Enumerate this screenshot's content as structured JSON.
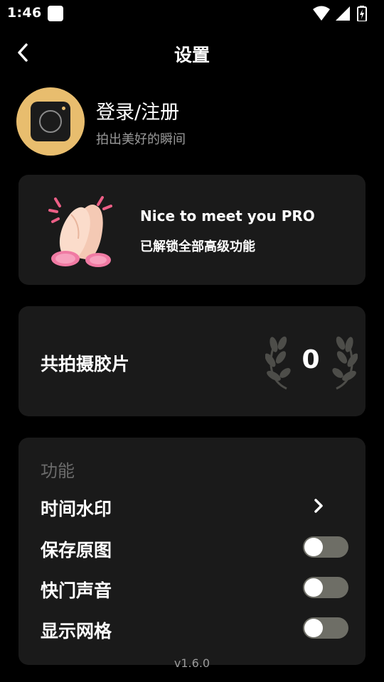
{
  "status_bar": {
    "time": "1:46",
    "icons": [
      "app-notification-icon",
      "wifi-icon",
      "cellular-signal-icon",
      "battery-icon"
    ]
  },
  "header": {
    "title": "设置",
    "back_icon": "chevron-left-icon"
  },
  "profile": {
    "login_label": "登录/注册",
    "tagline": "拍出美好的瞬间",
    "avatar_icon": "camera-icon"
  },
  "pro_card": {
    "icon": "clapping-hands-icon",
    "title": "Nice to meet you PRO",
    "subtitle": "已解锁全部高级功能"
  },
  "count_card": {
    "label": "共拍摄胶片",
    "value": "0",
    "icon": "laurel-wreath-icon"
  },
  "functions": {
    "heading": "功能",
    "items": [
      {
        "label": "时间水印",
        "control": "chevron-right-icon"
      },
      {
        "label": "保存原图",
        "control": "toggle",
        "on": false
      },
      {
        "label": "快门声音",
        "control": "toggle",
        "on": false
      },
      {
        "label": "显示网格",
        "control": "toggle",
        "on": false
      }
    ]
  },
  "version": "v1.6.0",
  "colors": {
    "background": "#000000",
    "card": "#1a1a1a",
    "avatar": "#E8BD6E",
    "toggle_off": "#6e6e66",
    "muted_text": "#9a9a9a"
  }
}
